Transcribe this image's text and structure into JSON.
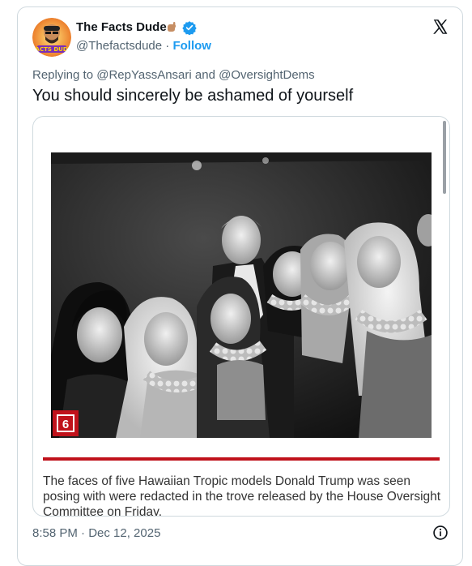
{
  "author": {
    "name": "The Facts Dude",
    "handle": "@Thefactsdude",
    "separator": "·",
    "follow_label": "Follow",
    "avatar_text": "FACTS DUDE"
  },
  "reply": {
    "prefix": "Replying to",
    "mention1": "@RepYassAnsari",
    "joiner": "and",
    "mention2": "@OversightDems"
  },
  "tweet": {
    "text": "You should sincerely be ashamed of yourself"
  },
  "media": {
    "badge": "6",
    "caption": "The faces of five Hawaiian Tropic models Donald Trump was seen posing with were redacted in the trove released by the House Oversight Committee on Friday."
  },
  "footer": {
    "timestamp": "8:58 PM · Dec 12, 2025"
  },
  "colors": {
    "accent": "#1d9bf0",
    "muted": "#536471",
    "red_rule": "#c0121b"
  },
  "icons": [
    "x-logo-icon",
    "verified-badge-icon",
    "hand-emoji-icon",
    "info-icon"
  ]
}
